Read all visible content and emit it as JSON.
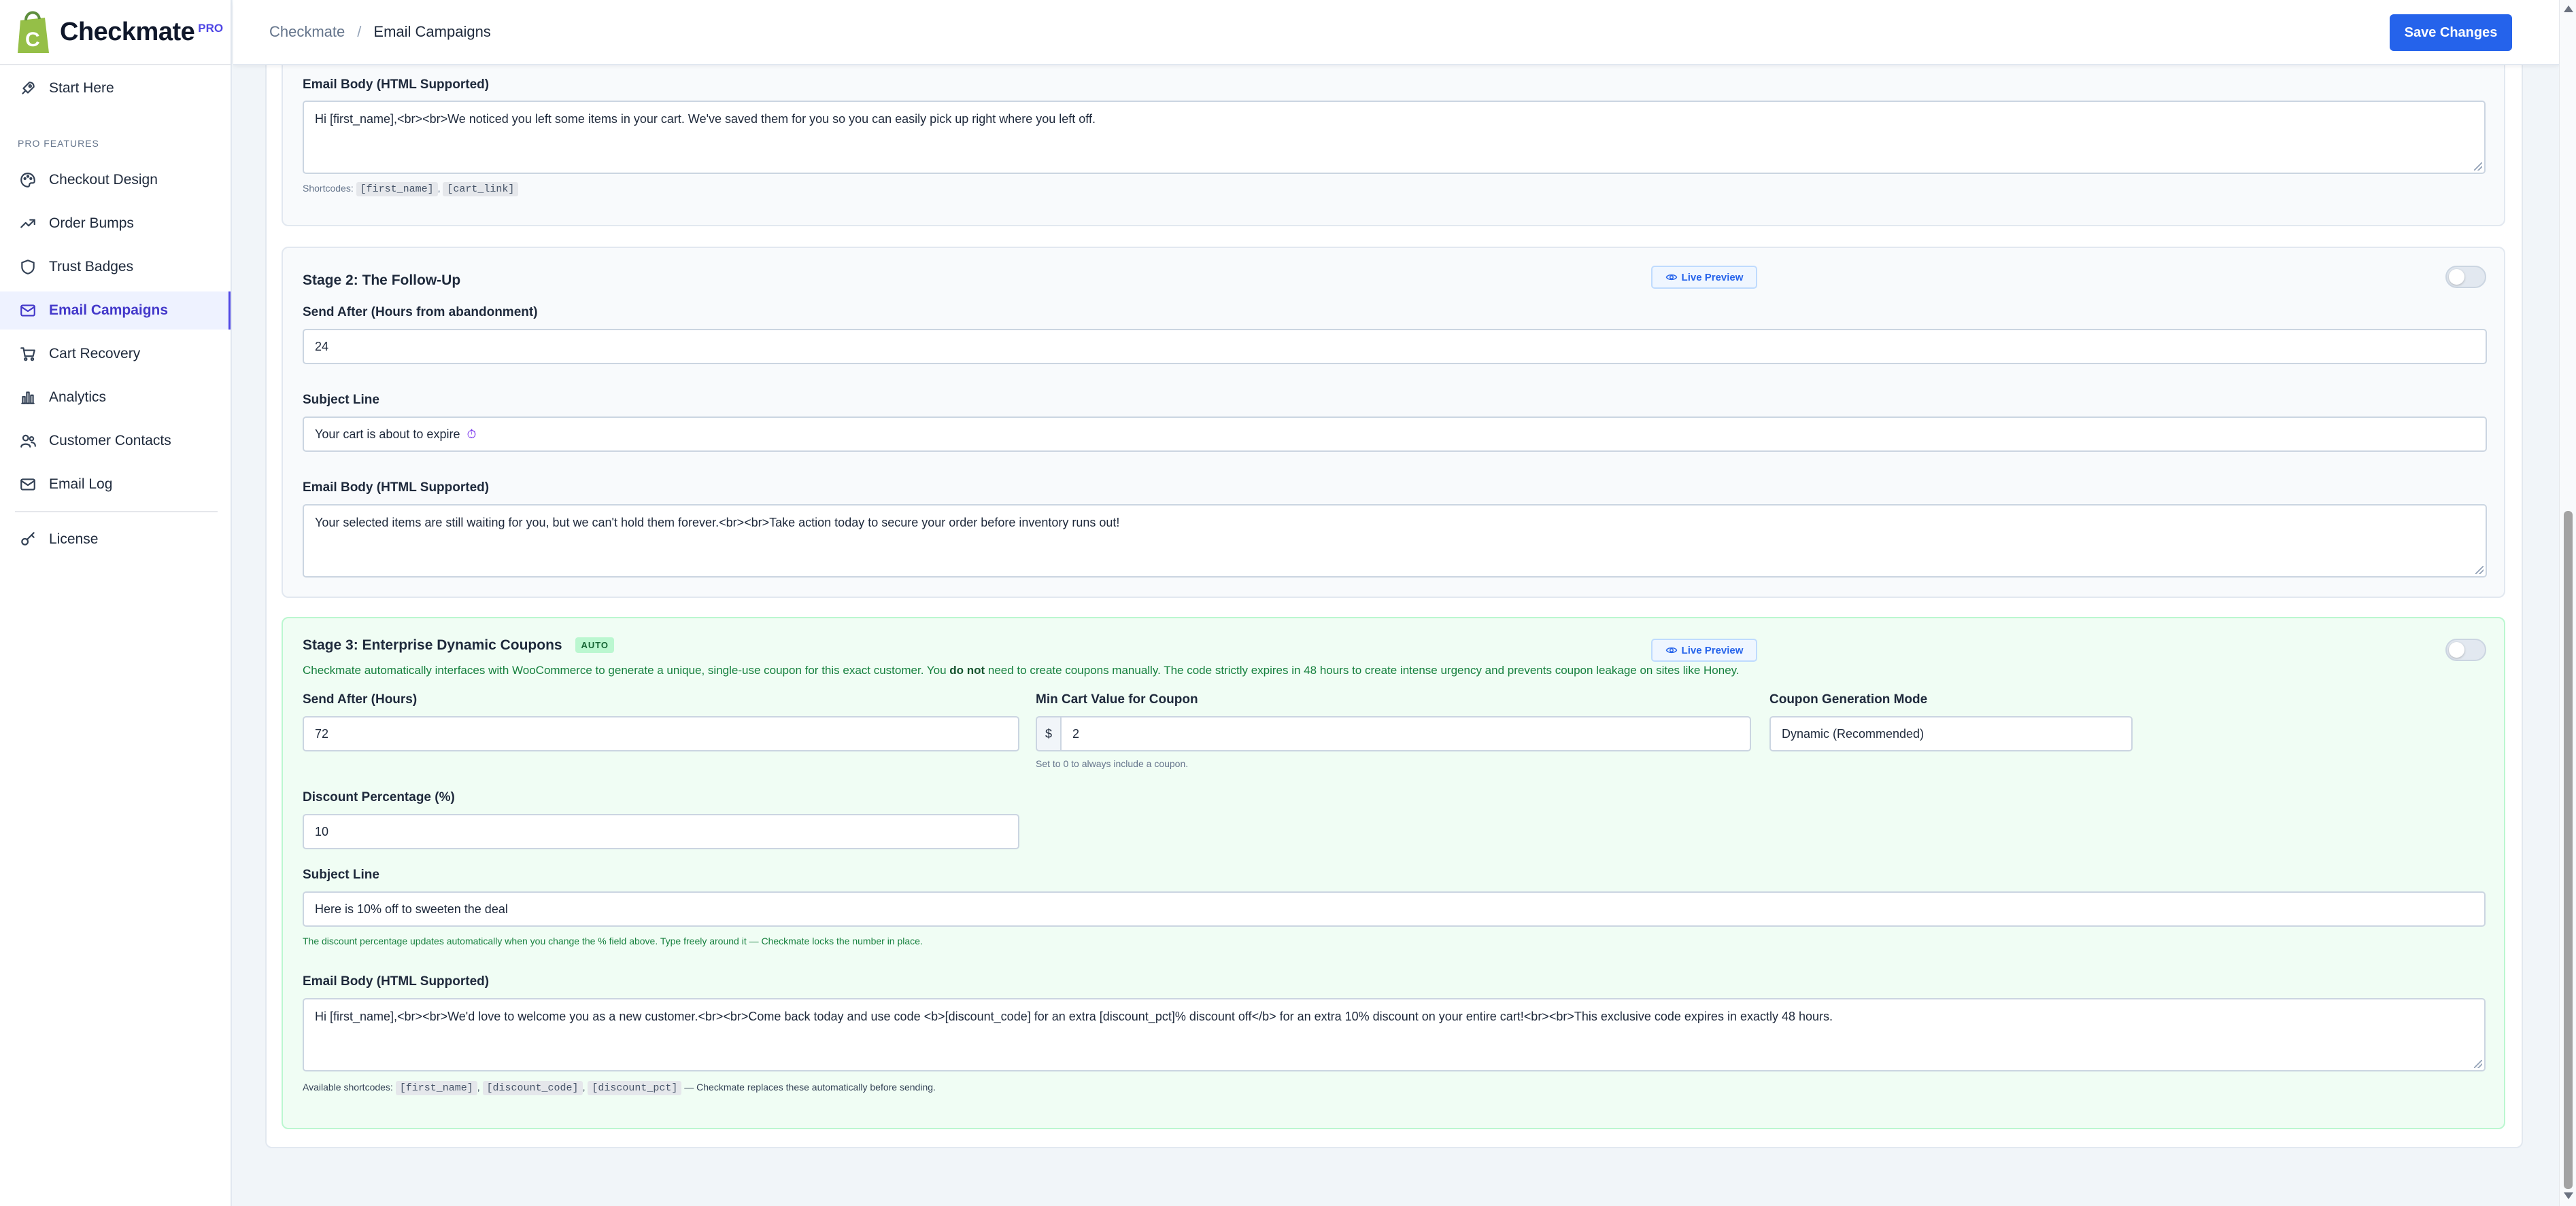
{
  "app": {
    "name": "Checkmate",
    "tier": "PRO"
  },
  "breadcrumb": {
    "root": "Checkmate",
    "separator": "/",
    "current": "Email Campaigns"
  },
  "toolbar": {
    "save_label": "Save Changes"
  },
  "sidebar": {
    "top_item": {
      "label": "Start Here",
      "icon": "rocket-icon"
    },
    "section_label": "PRO FEATURES",
    "items": [
      {
        "label": "Checkout Design",
        "icon": "palette-icon"
      },
      {
        "label": "Order Bumps",
        "icon": "trending-up-icon"
      },
      {
        "label": "Trust Badges",
        "icon": "shield-icon"
      },
      {
        "label": "Email Campaigns",
        "icon": "mail-icon",
        "active": true
      },
      {
        "label": "Cart Recovery",
        "icon": "cart-icon"
      },
      {
        "label": "Analytics",
        "icon": "bar-chart-icon"
      },
      {
        "label": "Customer Contacts",
        "icon": "users-icon"
      },
      {
        "label": "Email Log",
        "icon": "mail-log-icon"
      }
    ],
    "bottom_item": {
      "label": "License",
      "icon": "key-icon"
    }
  },
  "stage1": {
    "body_label": "Email Body (HTML Supported)",
    "body_value": "Hi [first_name],<br><br>We noticed you left some items in your cart. We've saved them for you so you can easily pick up right where you left off.",
    "shortcodes_label": "Shortcodes:",
    "shortcodes": [
      "[first_name]",
      "[cart_link]"
    ]
  },
  "stage2": {
    "title": "Stage 2: The Follow-Up",
    "preview_label": "Live Preview",
    "send_after_label": "Send After (Hours from abandonment)",
    "send_after_value": "24",
    "subject_label": "Subject Line",
    "subject_value": "Your cart is about to expire",
    "body_label": "Email Body (HTML Supported)",
    "body_value": "Your selected items are still waiting for you, but we can't hold them forever.<br><br>Take action today to secure your order before inventory runs out!"
  },
  "stage3": {
    "title": "Stage 3: Enterprise Dynamic Coupons",
    "badge": "AUTO",
    "preview_label": "Live Preview",
    "desc_before": "Checkmate automatically interfaces with WooCommerce to generate a unique, single-use coupon for this exact customer. You ",
    "desc_bold": "do not",
    "desc_after": " need to create coupons manually. The code strictly expires in 48 hours to create intense urgency and prevents coupon leakage on sites like Honey.",
    "send_after_label": "Send After (Hours)",
    "send_after_value": "72",
    "min_cart_label": "Min Cart Value for Coupon",
    "currency_symbol": "$",
    "min_cart_value": "2",
    "min_cart_hint": "Set to 0 to always include a coupon.",
    "mode_label": "Coupon Generation Mode",
    "mode_value": "Dynamic (Recommended)",
    "discount_label": "Discount Percentage (%)",
    "discount_value": "10",
    "subject_label": "Subject Line",
    "subject_value": "Here is 10% off to sweeten the deal",
    "subject_hint": "The discount percentage updates automatically when you change the % field above. Type freely around it — Checkmate locks the number in place.",
    "body_label": "Email Body (HTML Supported)",
    "body_value": "Hi [first_name],<br><br>We'd love to welcome you as a new customer.<br><br>Come back today and use code <b>[discount_code] for an extra [discount_pct]% discount off</b> for an extra 10% discount on your entire cart!<br><br>This exclusive code expires in exactly 48 hours.",
    "shortcodes_label": "Available shortcodes:",
    "shortcodes": [
      "[first_name]",
      "[discount_code]",
      "[discount_pct]"
    ],
    "shortcodes_suffix": "— Checkmate replaces these automatically before sending."
  },
  "colors": {
    "accent": "#2563eb",
    "brand": "#4f46e5",
    "logo_green": "#95bf47",
    "stage3_bg": "#f0fdf4"
  }
}
